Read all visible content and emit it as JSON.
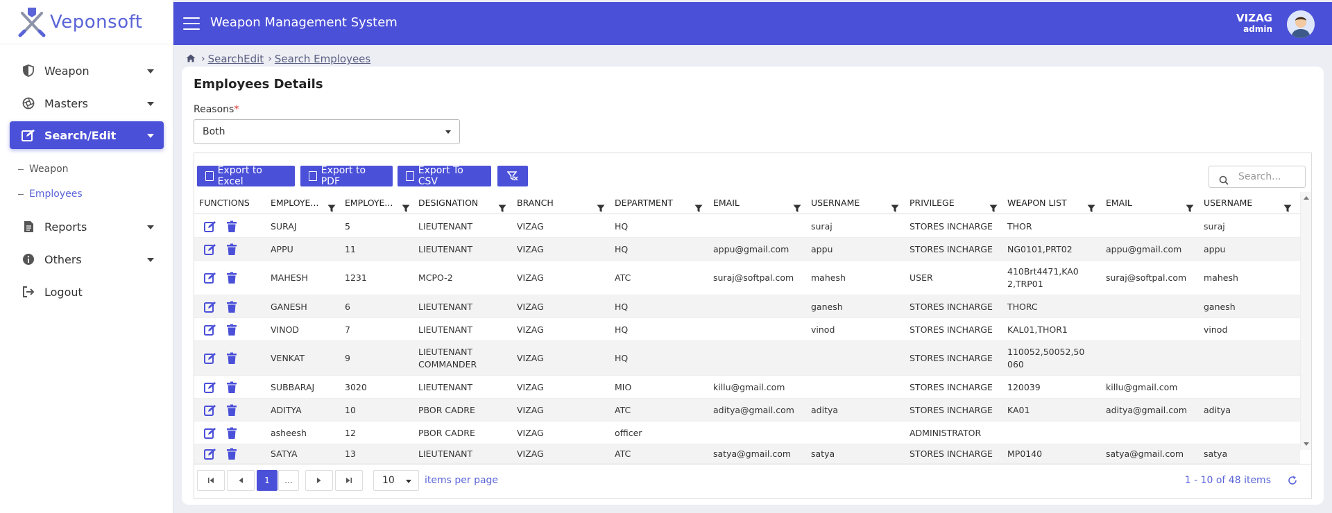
{
  "brand": {
    "name": "Veponsoft"
  },
  "header": {
    "title": "Weapon Management System",
    "location": "VIZAG",
    "role": "admin"
  },
  "sidebar": {
    "items": [
      {
        "label": "Weapon",
        "icon": "shield-icon"
      },
      {
        "label": "Masters",
        "icon": "aperture-icon"
      },
      {
        "label": "Search/Edit",
        "icon": "edit-icon"
      },
      {
        "label": "Reports",
        "icon": "document-icon"
      },
      {
        "label": "Others",
        "icon": "info-icon"
      },
      {
        "label": "Logout",
        "icon": "logout-icon"
      }
    ],
    "sub_items": [
      {
        "label": "Weapon"
      },
      {
        "label": "Employees"
      }
    ]
  },
  "breadcrumb": {
    "items": [
      "SearchEdit",
      "Search Employees"
    ]
  },
  "page": {
    "title": "Employees Details",
    "reasons_label": "Reasons",
    "reasons_required": "*",
    "reasons_value": "Both"
  },
  "toolbar": {
    "export_excel": "Export to Excel",
    "export_pdf": "Export to PDF",
    "export_csv": "Export To CSV",
    "search_placeholder": "Search..."
  },
  "table": {
    "columns": [
      "FUNCTIONS",
      "EMPLOYE...",
      "EMPLOYE...",
      "DESIGNATION",
      "BRANCH",
      "DEPARTMENT",
      "EMAIL",
      "USERNAME",
      "PRIVILEGE",
      "WEAPON LIST",
      "EMAIL",
      "USERNAME"
    ],
    "rows": [
      [
        "SURAJ",
        "5",
        "LIEUTENANT",
        "VIZAG",
        "HQ",
        "",
        "suraj",
        "STORES INCHARGE",
        "THOR",
        "",
        "suraj"
      ],
      [
        "APPU",
        "11",
        "LIEUTENANT",
        "VIZAG",
        "HQ",
        "appu@gmail.com",
        "appu",
        "STORES INCHARGE",
        "NG0101,PRT02",
        "appu@gmail.com",
        "appu"
      ],
      [
        "MAHESH",
        "1231",
        "MCPO-2",
        "VIZAG",
        "ATC",
        "suraj@softpal.com",
        "mahesh",
        "USER",
        "410Brt4471,KA02,TRP01",
        "suraj@softpal.com",
        "mahesh"
      ],
      [
        "GANESH",
        "6",
        "LIEUTENANT",
        "VIZAG",
        "HQ",
        "",
        "ganesh",
        "STORES INCHARGE",
        "THORC",
        "",
        "ganesh"
      ],
      [
        "VINOD",
        "7",
        "LIEUTENANT",
        "VIZAG",
        "HQ",
        "",
        "vinod",
        "STORES INCHARGE",
        "KAL01,THOR1",
        "",
        "vinod"
      ],
      [
        "VENKAT",
        "9",
        "LIEUTENANT COMMANDER",
        "VIZAG",
        "HQ",
        "",
        "",
        "STORES INCHARGE",
        "110052,50052,50060",
        "",
        ""
      ],
      [
        "SUBBARAJ",
        "3020",
        "LIEUTENANT",
        "VIZAG",
        "MIO",
        "killu@gmail.com",
        "",
        "STORES INCHARGE",
        "120039",
        "killu@gmail.com",
        ""
      ],
      [
        "ADITYA",
        "10",
        "PBOR CADRE",
        "VIZAG",
        "ATC",
        "aditya@gmail.com",
        "aditya",
        "STORES INCHARGE",
        "KA01",
        "aditya@gmail.com",
        "aditya"
      ],
      [
        "asheesh",
        "12",
        "PBOR CADRE",
        "VIZAG",
        "officer",
        "",
        "",
        "ADMINISTRATOR",
        "",
        "",
        ""
      ],
      [
        "SATYA",
        "13",
        "LIEUTENANT",
        "VIZAG",
        "ATC",
        "satya@gmail.com",
        "satya",
        "STORES INCHARGE",
        "MP0140",
        "satya@gmail.com",
        "satya"
      ]
    ]
  },
  "pager": {
    "current_page": "1",
    "ellipsis": "...",
    "page_size": "10",
    "items_per_page": "items per page",
    "info": "1 - 10 of 48 items"
  },
  "colors": {
    "accent": "#4b50d8",
    "link": "#5a64d8"
  }
}
